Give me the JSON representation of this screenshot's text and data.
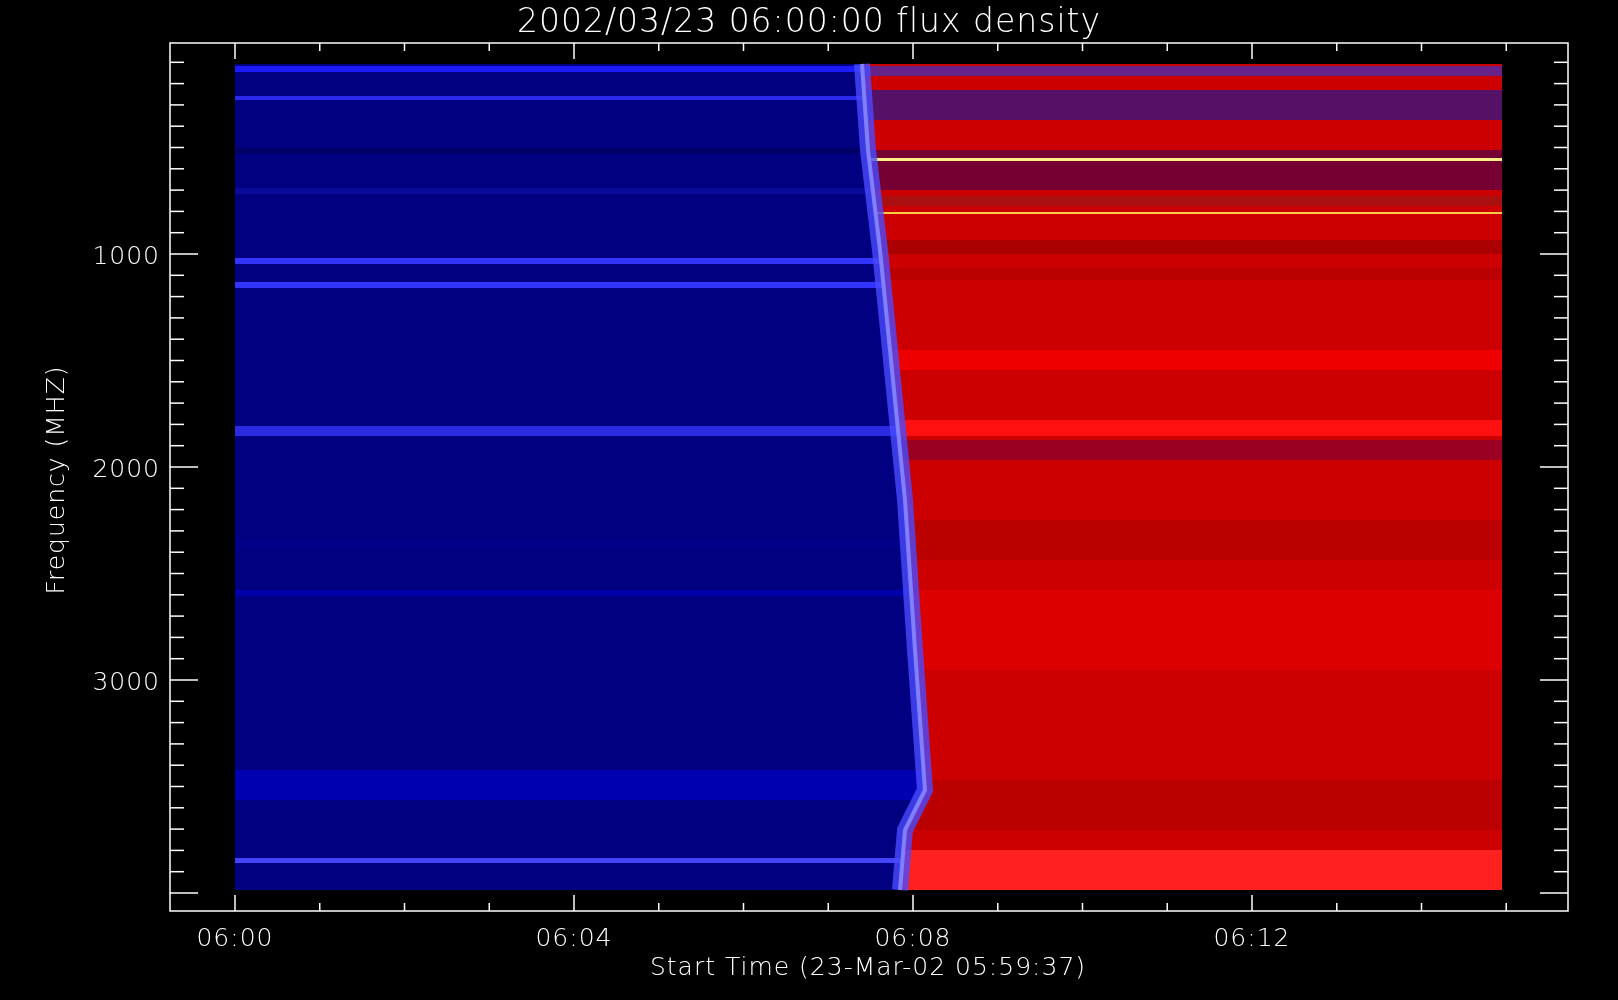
{
  "title": "2002/03/23 06:00:00 flux density",
  "x_axis": {
    "label": "Start Time (23-Mar-02 05:59:37)",
    "tick_labels": [
      "06:00",
      "06:04",
      "06:08",
      "06:12"
    ]
  },
  "y_axis": {
    "label": "Frequency (MHZ)",
    "tick_labels": [
      "1000",
      "2000",
      "3000"
    ]
  }
}
